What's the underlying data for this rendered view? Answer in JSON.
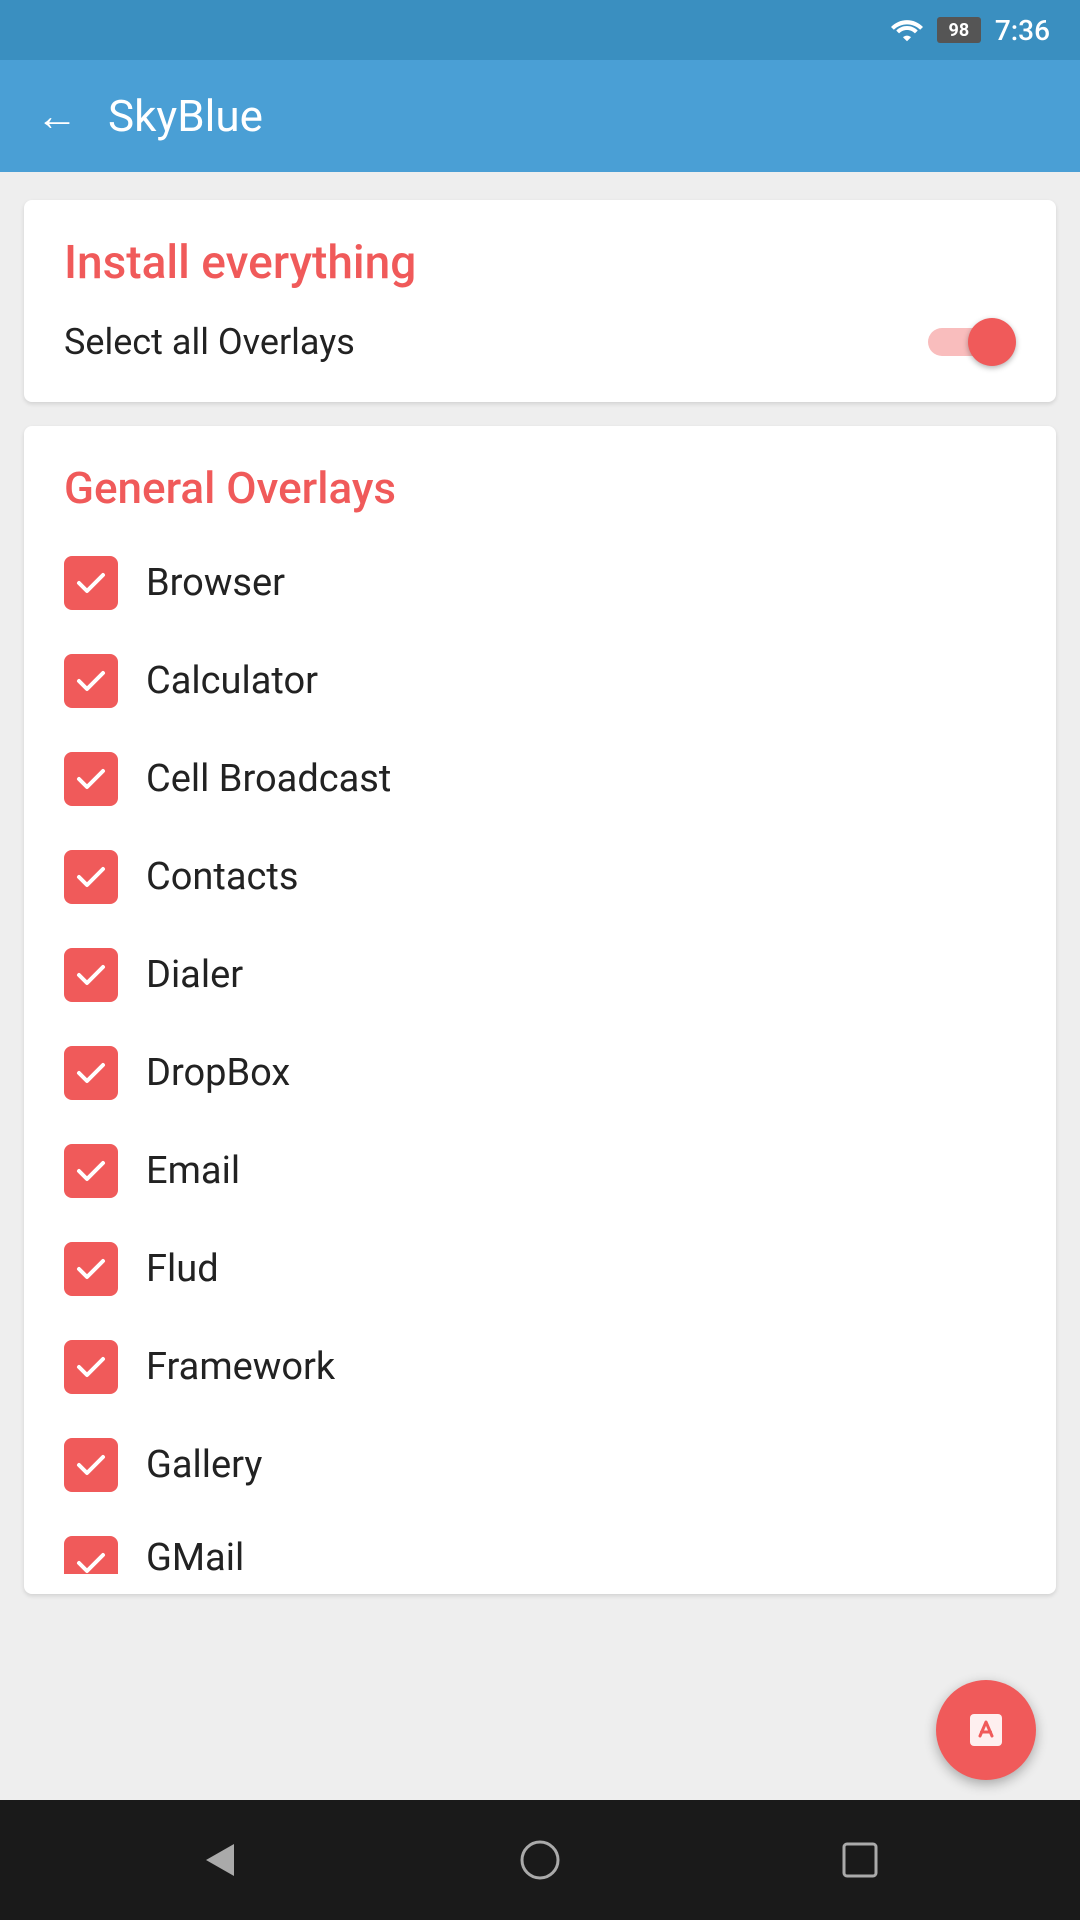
{
  "statusBar": {
    "time": "7:36",
    "batteryLevel": "98"
  },
  "appBar": {
    "title": "SkyBlue",
    "backLabel": "←"
  },
  "installCard": {
    "title": "Install everything",
    "toggleLabel": "Select all Overlays",
    "toggleState": true
  },
  "overlaysCard": {
    "sectionTitle": "General Overlays",
    "items": [
      {
        "label": "Browser",
        "checked": true
      },
      {
        "label": "Calculator",
        "checked": true
      },
      {
        "label": "Cell Broadcast",
        "checked": true
      },
      {
        "label": "Contacts",
        "checked": true
      },
      {
        "label": "Dialer",
        "checked": true
      },
      {
        "label": "DropBox",
        "checked": true
      },
      {
        "label": "Email",
        "checked": true
      },
      {
        "label": "Flud",
        "checked": true
      },
      {
        "label": "Framework",
        "checked": true
      },
      {
        "label": "Gallery",
        "checked": true
      },
      {
        "label": "GMail",
        "checked": true
      }
    ]
  },
  "fab": {
    "ariaLabel": "edit"
  },
  "bottomNav": {
    "back": "back",
    "home": "home",
    "recents": "recents"
  }
}
